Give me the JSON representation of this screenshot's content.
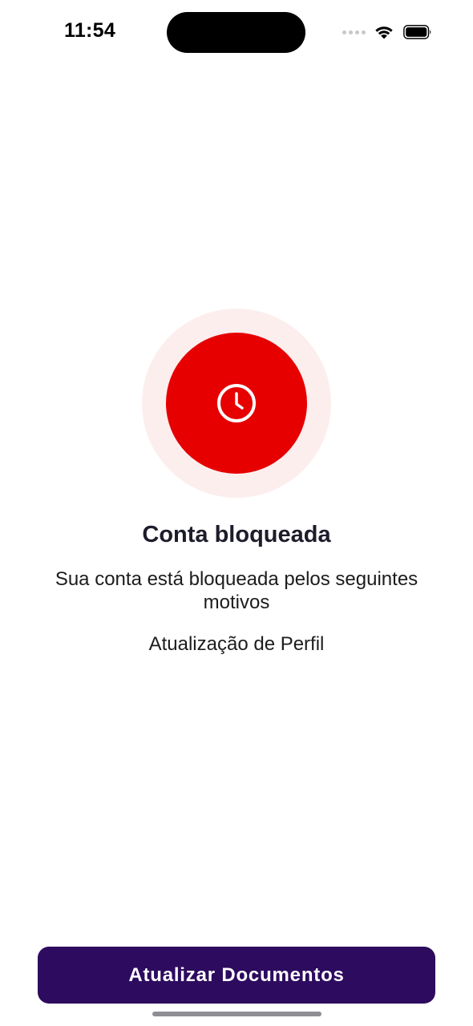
{
  "status_bar": {
    "time": "11:54",
    "icons": [
      "signal-dots-icon",
      "wifi-icon",
      "battery-icon"
    ]
  },
  "colors": {
    "accent_red": "#e60000",
    "accent_red_halo": "#fdeeee",
    "button_bg": "#2d0b5e"
  },
  "status_icon": "clock-icon",
  "main": {
    "title": "Conta bloqueada",
    "subtitle": "Sua conta está bloqueada pelos seguintes motivos",
    "reason": "Atualização de Perfil"
  },
  "actions": {
    "update_documents_label": "Atualizar Documentos"
  }
}
